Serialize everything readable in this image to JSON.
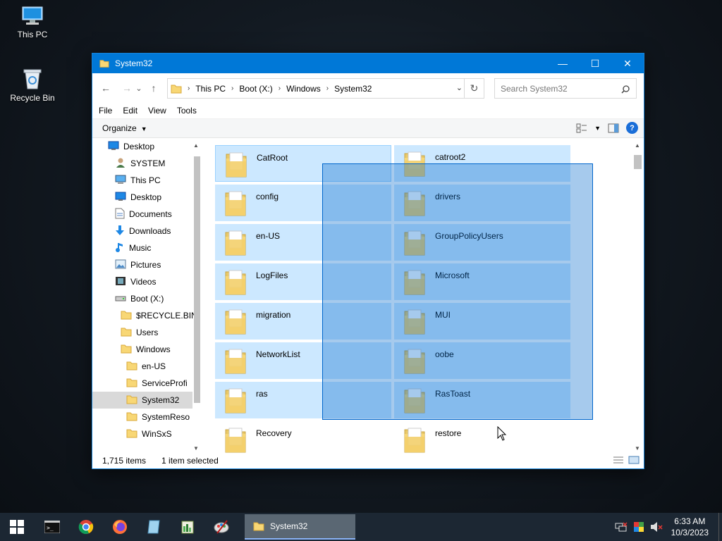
{
  "desktop": {
    "icons": [
      {
        "label": "This PC",
        "icon": "this-pc-icon"
      },
      {
        "label": "Recycle Bin",
        "icon": "recycle-bin-icon"
      }
    ]
  },
  "window": {
    "title": "System32",
    "controls": {
      "minimize": "—",
      "maximize": "☐",
      "close": "✕"
    },
    "nav": {
      "back": "←",
      "forward": "→",
      "recent": "⌄",
      "up": "↑"
    },
    "address": {
      "crumbs": [
        "This PC",
        "Boot (X:)",
        "Windows",
        "System32"
      ],
      "separator": "›"
    },
    "search": {
      "placeholder": "Search System32"
    },
    "menu": [
      "File",
      "Edit",
      "View",
      "Tools"
    ],
    "command_bar": {
      "organize": "Organize"
    },
    "nav_pane": {
      "items": [
        {
          "label": "Desktop",
          "icon": "desktop-icon",
          "indent": 0
        },
        {
          "label": "SYSTEM",
          "icon": "user-icon",
          "indent": 1
        },
        {
          "label": "This PC",
          "icon": "this-pc-icon",
          "indent": 1
        },
        {
          "label": "Desktop",
          "icon": "desktop-icon",
          "indent": 2
        },
        {
          "label": "Documents",
          "icon": "documents-icon",
          "indent": 2
        },
        {
          "label": "Downloads",
          "icon": "downloads-icon",
          "indent": 2
        },
        {
          "label": "Music",
          "icon": "music-icon",
          "indent": 2
        },
        {
          "label": "Pictures",
          "icon": "pictures-icon",
          "indent": 2
        },
        {
          "label": "Videos",
          "icon": "videos-icon",
          "indent": 2
        },
        {
          "label": "Boot (X:)",
          "icon": "drive-icon",
          "indent": 2
        },
        {
          "label": "$RECYCLE.BIN",
          "icon": "folder-icon",
          "indent": 3
        },
        {
          "label": "Users",
          "icon": "folder-icon",
          "indent": 3
        },
        {
          "label": "Windows",
          "icon": "folder-icon",
          "indent": 3
        },
        {
          "label": "en-US",
          "icon": "folder-icon",
          "indent": 4
        },
        {
          "label": "ServiceProfi",
          "icon": "folder-icon",
          "indent": 4
        },
        {
          "label": "System32",
          "icon": "folder-icon",
          "indent": 4,
          "selected": true
        },
        {
          "label": "SystemReso",
          "icon": "folder-icon",
          "indent": 4
        },
        {
          "label": "WinSxS",
          "icon": "folder-icon",
          "indent": 4
        }
      ]
    },
    "content": {
      "folders": [
        {
          "name": "CatRoot",
          "selected": true
        },
        {
          "name": "catroot2",
          "selected": true
        },
        {
          "name": "config",
          "selected": true
        },
        {
          "name": "drivers",
          "selected": true
        },
        {
          "name": "en-US",
          "selected": true
        },
        {
          "name": "GroupPolicyUsers",
          "selected": true
        },
        {
          "name": "LogFiles",
          "selected": true
        },
        {
          "name": "Microsoft",
          "selected": true
        },
        {
          "name": "migration",
          "selected": true
        },
        {
          "name": "MUI",
          "selected": true
        },
        {
          "name": "NetworkList",
          "selected": true
        },
        {
          "name": "oobe",
          "selected": true
        },
        {
          "name": "ras",
          "selected": true
        },
        {
          "name": "RasToast",
          "selected": true
        },
        {
          "name": "Recovery",
          "selected": false
        },
        {
          "name": "restore",
          "selected": false
        }
      ]
    },
    "status": {
      "item_count": "1,715 items",
      "selection": "1 item selected"
    }
  },
  "taskbar": {
    "start_icon": "windows-start-icon",
    "pinned": [
      "cmd-icon",
      "chrome-icon",
      "firefox-icon",
      "notepad-icon",
      "registry-editor-icon",
      "paint-icon"
    ],
    "active_app": {
      "label": "System32",
      "icon": "folder-icon"
    },
    "tray": {
      "time": "6:33 AM",
      "date": "10/3/2023"
    }
  },
  "colors": {
    "title_bar": "#0078d7",
    "selection": "#cce8ff",
    "marquee": "#0066cc",
    "taskbar": "#1c2733"
  }
}
